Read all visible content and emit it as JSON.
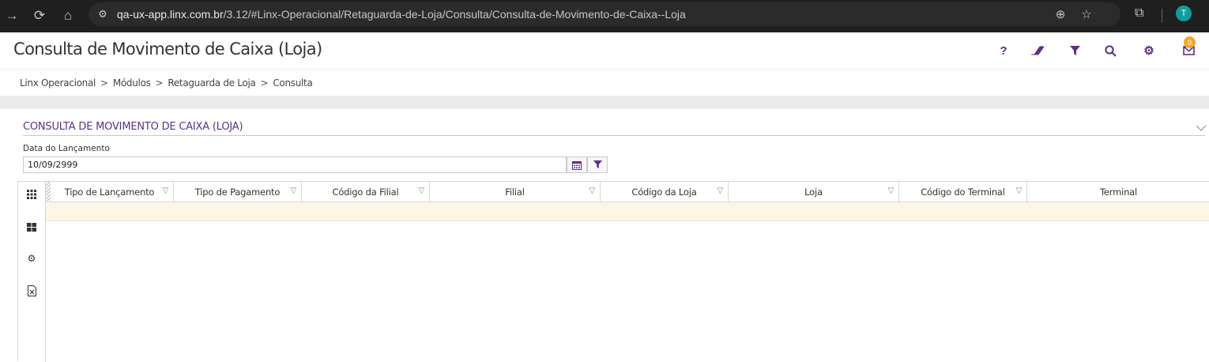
{
  "browser": {
    "url_host": "qa-ux-app.linx.com.br",
    "url_path": "/3.12/#Linx-Operacional/Retaguarda-de-Loja/Consulta/Consulta-de-Movimento-de-Caixa--Loja",
    "profile_initial": "T"
  },
  "header": {
    "title": "Consulta de Movimento de Caixa (Loja)",
    "notification_count": "0"
  },
  "breadcrumb": [
    "Linx Operacional",
    "Módulos",
    "Retaguarda de Loja",
    "Consulta"
  ],
  "breadcrumb_separator": ">",
  "panel": {
    "title": "CONSULTA DE MOVIMENTO DE CAIXA (LOJA)",
    "date_label": "Data do Lançamento",
    "date_value": "10/09/2999"
  },
  "grid": {
    "columns": [
      "Tipo de Lançamento",
      "Tipo de Pagamento",
      "Código da Filial",
      "Filial",
      "Código da Loja",
      "Loja",
      "Código do Terminal",
      "Terminal"
    ],
    "rows": []
  },
  "colors": {
    "accent": "#5e2f89",
    "chrome_bg": "#1f1f1f",
    "empty_row": "#fdf5e6",
    "badge": "#f5a623"
  }
}
